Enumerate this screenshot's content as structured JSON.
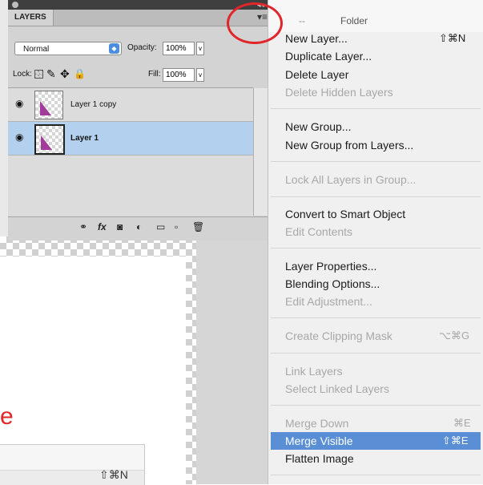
{
  "panel": {
    "tab_label": "LAYERS",
    "blend_mode": "Normal",
    "opacity_label": "Opacity:",
    "opacity_value": "100%",
    "lock_label": "Lock:",
    "fill_label": "Fill:",
    "fill_value": "100%",
    "layers": [
      {
        "name": "Layer 1 copy",
        "selected": false
      },
      {
        "name": "Layer 1",
        "selected": true
      }
    ],
    "toolbar_icons": [
      "link-icon",
      "fx-icon",
      "mask-icon",
      "adjustment-icon",
      "folder-icon",
      "new-layer-icon",
      "trash-icon"
    ]
  },
  "behind_menu": {
    "dashes": "--",
    "folder_label": "Folder"
  },
  "menu": {
    "items": [
      {
        "label": "New Layer...",
        "shortcut": "⇧⌘N",
        "enabled": true
      },
      {
        "label": "Duplicate Layer...",
        "shortcut": "",
        "enabled": true
      },
      {
        "label": "Delete Layer",
        "shortcut": "",
        "enabled": true
      },
      {
        "label": "Delete Hidden Layers",
        "shortcut": "",
        "enabled": false
      },
      {
        "label": "New Group...",
        "shortcut": "",
        "enabled": true
      },
      {
        "label": "New Group from Layers...",
        "shortcut": "",
        "enabled": true
      },
      {
        "label": "Lock All Layers in Group...",
        "shortcut": "",
        "enabled": false
      },
      {
        "label": "Convert to Smart Object",
        "shortcut": "",
        "enabled": true
      },
      {
        "label": "Edit Contents",
        "shortcut": "",
        "enabled": false
      },
      {
        "label": "Layer Properties...",
        "shortcut": "",
        "enabled": true
      },
      {
        "label": "Blending Options...",
        "shortcut": "",
        "enabled": true
      },
      {
        "label": "Edit Adjustment...",
        "shortcut": "",
        "enabled": false
      },
      {
        "label": "Create Clipping Mask",
        "shortcut": "⌥⌘G",
        "enabled": false
      },
      {
        "label": "Link Layers",
        "shortcut": "",
        "enabled": false
      },
      {
        "label": "Select Linked Layers",
        "shortcut": "",
        "enabled": false
      },
      {
        "label": "Merge Down",
        "shortcut": "⌘E",
        "enabled": false
      },
      {
        "label": "Merge Visible",
        "shortcut": "⇧⌘E",
        "enabled": true,
        "highlighted": true
      },
      {
        "label": "Flatten Image",
        "shortcut": "",
        "enabled": true
      }
    ]
  },
  "background": {
    "red_text": "e",
    "mini_shortcut": "⇧⌘N"
  },
  "colors": {
    "highlight": "#5a8fd6",
    "selected_layer": "#b3d1ee",
    "annotation_red": "#e0262b"
  }
}
